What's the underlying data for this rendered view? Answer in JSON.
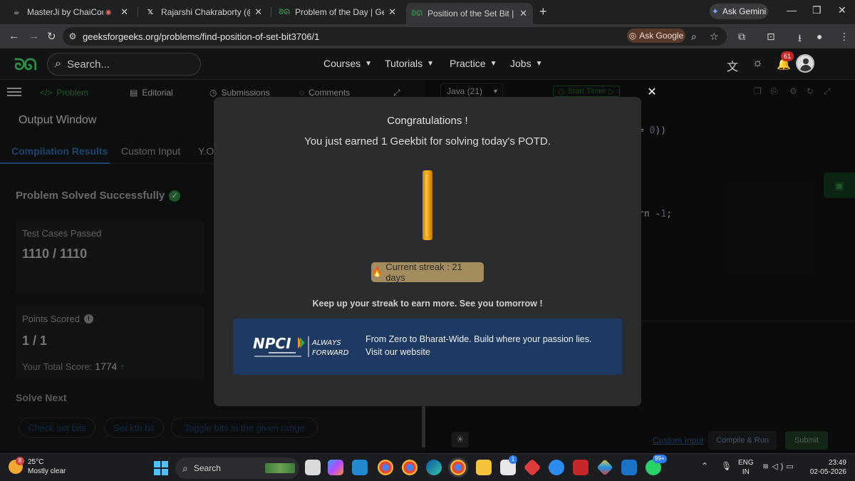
{
  "browser": {
    "tabs": [
      {
        "title": "MasterJi by ChaiCode",
        "favicon": "chaicode-icon",
        "close": "✕"
      },
      {
        "title": "Rajarshi Chakraborty (@IamRaj",
        "favicon": "x-icon",
        "close": "✕"
      },
      {
        "title": "Problem of the Day | GeeksforG",
        "favicon": "gfg-icon",
        "close": "✕"
      },
      {
        "title": "Position of the Set Bit | Practice",
        "favicon": "gfg-icon",
        "close": "✕"
      }
    ],
    "new_tab": "+",
    "ask_gemini": "Ask Gemini",
    "url": "geeksforgeeks.org/problems/find-position-of-set-bit3706/1",
    "ask_google": "Ask Google"
  },
  "site": {
    "search_placeholder": "Search...",
    "nav": [
      "Courses",
      "Tutorials",
      "Practice",
      "Jobs"
    ],
    "notification_count": "61"
  },
  "left_panel": {
    "tabs": [
      "Problem",
      "Editorial",
      "Submissions",
      "Comments"
    ],
    "output_title": "Output Window",
    "subtabs": [
      "Compilation Results",
      "Custom Input",
      "Y.O."
    ],
    "status": "Problem Solved Successfully",
    "test_cases_label": "Test Cases Passed",
    "test_cases_value": "1110 / 1110",
    "points_label": "Points Scored",
    "points_value": "1 / 1",
    "total_score_label": "Your Total Score:",
    "total_score_value": "1774",
    "solve_next_label": "Solve Next",
    "solve_next": [
      "Check set bits",
      "Set kth bit",
      "Toggle bits in the given range"
    ]
  },
  "editor": {
    "language": "Java (21)",
    "timer_label": "Start Timer",
    "code_line1_a": "= ",
    "code_line1_num": "0",
    "code_line1_b": "))",
    "code_line2_a": "rn -",
    "code_line2_num": "1",
    "code_line2_b": ";",
    "custom_input": "Custom Input",
    "compile_run": "Compile & Run",
    "submit": "Submit"
  },
  "modal": {
    "title": "Congratulations !",
    "subtitle": "You just earned 1 Geekbit for solving today's POTD.",
    "streak": "Current streak : 21 days",
    "message": "Keep up your streak to earn more. See you tomorrow !",
    "banner_text": "From Zero to Bharat-Wide. Build where your passion lies. Visit our website",
    "banner_logo_text": "NPCI",
    "banner_tagline": "ALWAYS FORWARD",
    "close": "✕"
  },
  "taskbar": {
    "weather_temp": "25°C",
    "weather_desc": "Mostly clear",
    "weather_badge": "8",
    "search_label": "Search",
    "lang_line1": "ENG",
    "lang_line2": "IN",
    "time": "23:49",
    "date": "02-05-2026",
    "whatsapp_badge": "99+",
    "store_badge": "1"
  },
  "colors": {
    "gfg_green": "#2f8d46",
    "link_blue": "#2f6db4",
    "banner_blue": "#1e3a63",
    "streak_gold": "#a38d5e",
    "coin_gold": "#f6b62a"
  }
}
